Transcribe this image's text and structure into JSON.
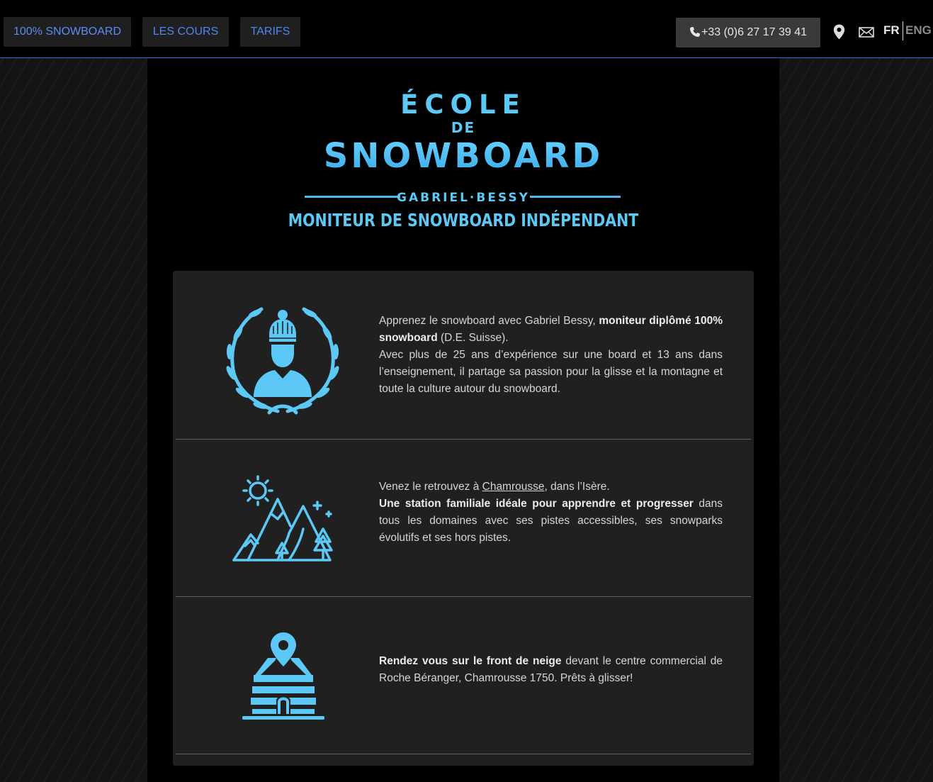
{
  "nav": {
    "items": [
      {
        "label": "100% SNOWBOARD"
      },
      {
        "label": "LES COURS"
      },
      {
        "label": "TARIFS"
      }
    ],
    "phone": "+33 (0)6 27 17 39 41",
    "lang_fr": "FR",
    "lang_en": "ENG"
  },
  "logo": {
    "line1": "ÉCOLE",
    "line2": "DE",
    "line3": "SNOWBOARD",
    "name": "GABRIEL·BESSY",
    "tagline": "MONITEUR DE SNOWBOARD INDÉPENDANT"
  },
  "rows": [
    {
      "icon": "instructor-laurel-icon",
      "p1_a": "Apprenez le snowboard avec Gabriel Bessy, ",
      "p1_b": "moniteur diplômé 100% snowboard",
      "p1_c": " (D.E. Suisse).",
      "p2": "Avec plus de 25 ans d’expérience sur une board et 13 ans dans l’enseignement, il partage sa passion pour la glisse et la montagne et toute la culture autour du snowboard."
    },
    {
      "icon": "mountains-sun-icon",
      "p1_a": "Venez le retrouvez à ",
      "p1_link": "Chamrousse",
      "p1_c": ", dans l’Isère.",
      "p2_b": "Une station familiale idéale pour apprendre et progresser",
      "p2_c": " dans tous les domaines avec ses pistes accessibles, ses snowparks évolutifs et ses hors pistes."
    },
    {
      "icon": "igloo-location-icon",
      "p1_b": "Rendez vous sur le front de neige",
      "p1_c": " devant le centre commercial de Roche Béranger, Chamrousse 1750. Prêts à glisser!"
    }
  ],
  "colors": {
    "accent": "#5cc8f5",
    "nav_link": "#5b8ef2",
    "panel": "#202020"
  }
}
